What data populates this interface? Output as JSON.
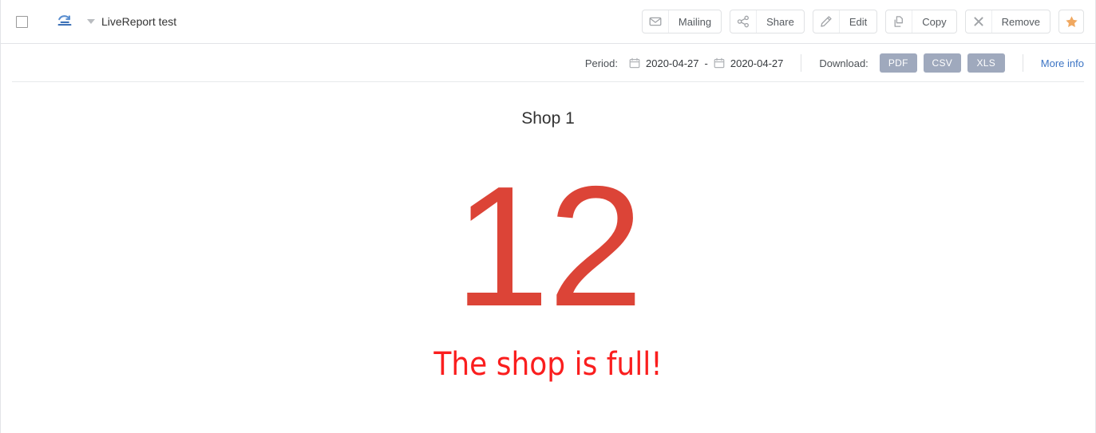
{
  "header": {
    "checkbox_checked": false,
    "live_icon": "livereport-icon",
    "caret": "chevron-down-icon",
    "report_title": "LiveReport test",
    "buttons": [
      {
        "id": "mailing",
        "label": "Mailing",
        "icon": "envelope-icon"
      },
      {
        "id": "share",
        "label": "Share",
        "icon": "share-nodes-icon"
      },
      {
        "id": "edit",
        "label": "Edit",
        "icon": "pencil-icon"
      },
      {
        "id": "copy",
        "label": "Copy",
        "icon": "copy-pages-icon"
      },
      {
        "id": "remove",
        "label": "Remove",
        "icon": "close-x-icon"
      }
    ],
    "favorite": {
      "id": "favorite",
      "icon": "star-icon",
      "color": "#f0a860",
      "active": true
    }
  },
  "subbar": {
    "period_label": "Period:",
    "date_from": "2020-04-27",
    "date_to": "2020-04-27",
    "date_separator": "-",
    "calendar_icon": "calendar-icon",
    "download_label": "Download:",
    "download_formats": [
      "PDF",
      "CSV",
      "XLS"
    ],
    "more_info": "More info"
  },
  "widget": {
    "title": "Shop 1",
    "value": "12",
    "caption": "The shop is full!",
    "value_color": "#dc4437",
    "caption_color": "#fa1e1e"
  },
  "theme": {
    "accent_link": "#3c74c4",
    "download_button_bg": "#9fa9bd",
    "border": "#e2e4e7",
    "star": "#f0a860"
  }
}
